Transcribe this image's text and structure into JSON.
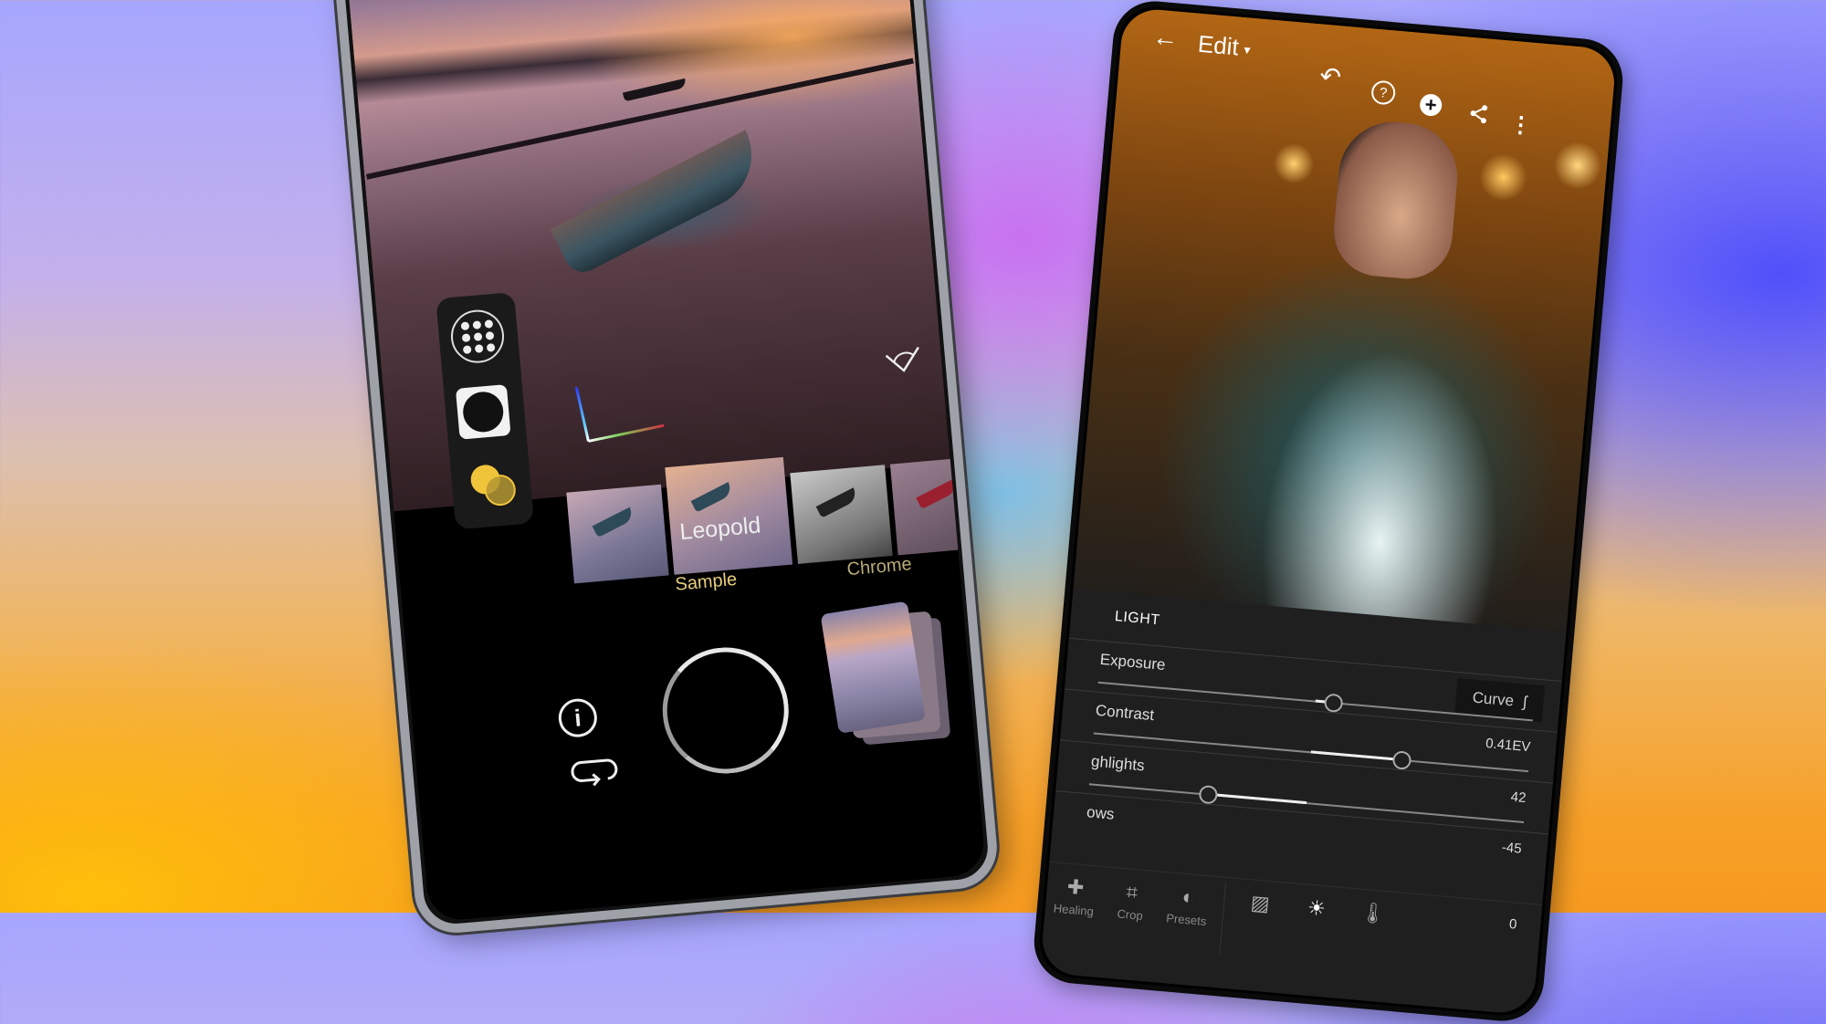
{
  "background": {
    "top_left": "#a6a6fe",
    "top_right": "#6a5cf8",
    "bottom_left": "#ffb80a",
    "bottom_center": "#f59a20"
  },
  "camera_app": {
    "photo_subject": "boat-on-lake-sunset",
    "tool_rail": [
      {
        "name": "lens",
        "icon": "lens-dots-icon"
      },
      {
        "name": "shape",
        "icon": "circle-in-square-icon"
      },
      {
        "name": "color",
        "icon": "overlapping-circles-icon",
        "accent": "#f0c43a"
      }
    ],
    "rotate_icon": "rotate-angle-icon",
    "filters": [
      "",
      "Leopold",
      "",
      "",
      ""
    ],
    "selected_filter": "Leopold",
    "filter_tabs": [
      {
        "label": "Sample",
        "selected": true,
        "color": "#e6cc7e"
      },
      {
        "label": "Chrome",
        "selected": false,
        "color": "#b9ab76"
      }
    ],
    "controls": {
      "info": "i",
      "shutter": "shutter-button",
      "loop": "loop-icon",
      "gallery": "gallery-stack"
    }
  },
  "editor_app": {
    "header": {
      "back": "←",
      "title": "Edit",
      "caret": "▾",
      "undo": "↶",
      "help": "?",
      "add": "+",
      "more": "⋮"
    },
    "section": "LIGHT",
    "curve_label": "Curve",
    "sliders": [
      {
        "label": "Exposure",
        "value_text": "0.41EV",
        "value": 0.41,
        "min": -5,
        "max": 5
      },
      {
        "label": "Contrast",
        "value_text": "42",
        "value": 42,
        "min": -100,
        "max": 100
      },
      {
        "label": "ghlights",
        "value_text": "-45",
        "value": -45,
        "min": -100,
        "max": 100
      },
      {
        "label": "ows",
        "value_text": "0",
        "value": 0,
        "min": -100,
        "max": 100
      }
    ],
    "toolbar": [
      {
        "label": "Healing",
        "icon": "bandage-icon",
        "glyph": "✚"
      },
      {
        "label": "Crop",
        "icon": "crop-icon",
        "glyph": "⌗"
      },
      {
        "label": "Presets",
        "icon": "presets-icon",
        "glyph": "◐"
      },
      {
        "label": "Auto",
        "icon": "auto-image-icon",
        "glyph": "▨"
      },
      {
        "label": "Light",
        "icon": "sun-icon",
        "glyph": "☀"
      },
      {
        "label": "Color",
        "icon": "thermometer-icon",
        "glyph": "🌡"
      }
    ],
    "toolbar_value": "0"
  }
}
